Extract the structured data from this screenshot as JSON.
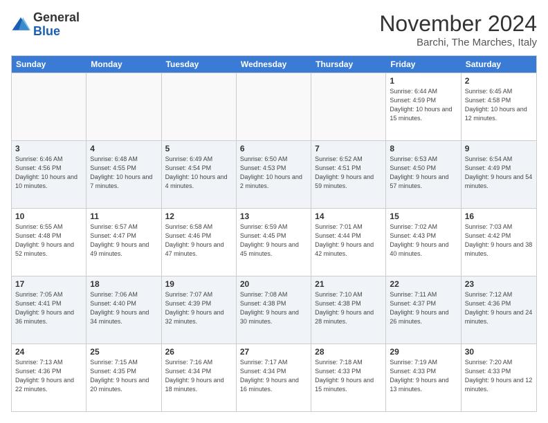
{
  "logo": {
    "general": "General",
    "blue": "Blue"
  },
  "title": "November 2024",
  "subtitle": "Barchi, The Marches, Italy",
  "header_days": [
    "Sunday",
    "Monday",
    "Tuesday",
    "Wednesday",
    "Thursday",
    "Friday",
    "Saturday"
  ],
  "rows": [
    [
      {
        "day": "",
        "info": ""
      },
      {
        "day": "",
        "info": ""
      },
      {
        "day": "",
        "info": ""
      },
      {
        "day": "",
        "info": ""
      },
      {
        "day": "",
        "info": ""
      },
      {
        "day": "1",
        "info": "Sunrise: 6:44 AM\nSunset: 4:59 PM\nDaylight: 10 hours\nand 15 minutes."
      },
      {
        "day": "2",
        "info": "Sunrise: 6:45 AM\nSunset: 4:58 PM\nDaylight: 10 hours\nand 12 minutes."
      }
    ],
    [
      {
        "day": "3",
        "info": "Sunrise: 6:46 AM\nSunset: 4:56 PM\nDaylight: 10 hours\nand 10 minutes."
      },
      {
        "day": "4",
        "info": "Sunrise: 6:48 AM\nSunset: 4:55 PM\nDaylight: 10 hours\nand 7 minutes."
      },
      {
        "day": "5",
        "info": "Sunrise: 6:49 AM\nSunset: 4:54 PM\nDaylight: 10 hours\nand 4 minutes."
      },
      {
        "day": "6",
        "info": "Sunrise: 6:50 AM\nSunset: 4:53 PM\nDaylight: 10 hours\nand 2 minutes."
      },
      {
        "day": "7",
        "info": "Sunrise: 6:52 AM\nSunset: 4:51 PM\nDaylight: 9 hours\nand 59 minutes."
      },
      {
        "day": "8",
        "info": "Sunrise: 6:53 AM\nSunset: 4:50 PM\nDaylight: 9 hours\nand 57 minutes."
      },
      {
        "day": "9",
        "info": "Sunrise: 6:54 AM\nSunset: 4:49 PM\nDaylight: 9 hours\nand 54 minutes."
      }
    ],
    [
      {
        "day": "10",
        "info": "Sunrise: 6:55 AM\nSunset: 4:48 PM\nDaylight: 9 hours\nand 52 minutes."
      },
      {
        "day": "11",
        "info": "Sunrise: 6:57 AM\nSunset: 4:47 PM\nDaylight: 9 hours\nand 49 minutes."
      },
      {
        "day": "12",
        "info": "Sunrise: 6:58 AM\nSunset: 4:46 PM\nDaylight: 9 hours\nand 47 minutes."
      },
      {
        "day": "13",
        "info": "Sunrise: 6:59 AM\nSunset: 4:45 PM\nDaylight: 9 hours\nand 45 minutes."
      },
      {
        "day": "14",
        "info": "Sunrise: 7:01 AM\nSunset: 4:44 PM\nDaylight: 9 hours\nand 42 minutes."
      },
      {
        "day": "15",
        "info": "Sunrise: 7:02 AM\nSunset: 4:43 PM\nDaylight: 9 hours\nand 40 minutes."
      },
      {
        "day": "16",
        "info": "Sunrise: 7:03 AM\nSunset: 4:42 PM\nDaylight: 9 hours\nand 38 minutes."
      }
    ],
    [
      {
        "day": "17",
        "info": "Sunrise: 7:05 AM\nSunset: 4:41 PM\nDaylight: 9 hours\nand 36 minutes."
      },
      {
        "day": "18",
        "info": "Sunrise: 7:06 AM\nSunset: 4:40 PM\nDaylight: 9 hours\nand 34 minutes."
      },
      {
        "day": "19",
        "info": "Sunrise: 7:07 AM\nSunset: 4:39 PM\nDaylight: 9 hours\nand 32 minutes."
      },
      {
        "day": "20",
        "info": "Sunrise: 7:08 AM\nSunset: 4:38 PM\nDaylight: 9 hours\nand 30 minutes."
      },
      {
        "day": "21",
        "info": "Sunrise: 7:10 AM\nSunset: 4:38 PM\nDaylight: 9 hours\nand 28 minutes."
      },
      {
        "day": "22",
        "info": "Sunrise: 7:11 AM\nSunset: 4:37 PM\nDaylight: 9 hours\nand 26 minutes."
      },
      {
        "day": "23",
        "info": "Sunrise: 7:12 AM\nSunset: 4:36 PM\nDaylight: 9 hours\nand 24 minutes."
      }
    ],
    [
      {
        "day": "24",
        "info": "Sunrise: 7:13 AM\nSunset: 4:36 PM\nDaylight: 9 hours\nand 22 minutes."
      },
      {
        "day": "25",
        "info": "Sunrise: 7:15 AM\nSunset: 4:35 PM\nDaylight: 9 hours\nand 20 minutes."
      },
      {
        "day": "26",
        "info": "Sunrise: 7:16 AM\nSunset: 4:34 PM\nDaylight: 9 hours\nand 18 minutes."
      },
      {
        "day": "27",
        "info": "Sunrise: 7:17 AM\nSunset: 4:34 PM\nDaylight: 9 hours\nand 16 minutes."
      },
      {
        "day": "28",
        "info": "Sunrise: 7:18 AM\nSunset: 4:33 PM\nDaylight: 9 hours\nand 15 minutes."
      },
      {
        "day": "29",
        "info": "Sunrise: 7:19 AM\nSunset: 4:33 PM\nDaylight: 9 hours\nand 13 minutes."
      },
      {
        "day": "30",
        "info": "Sunrise: 7:20 AM\nSunset: 4:33 PM\nDaylight: 9 hours\nand 12 minutes."
      }
    ]
  ]
}
